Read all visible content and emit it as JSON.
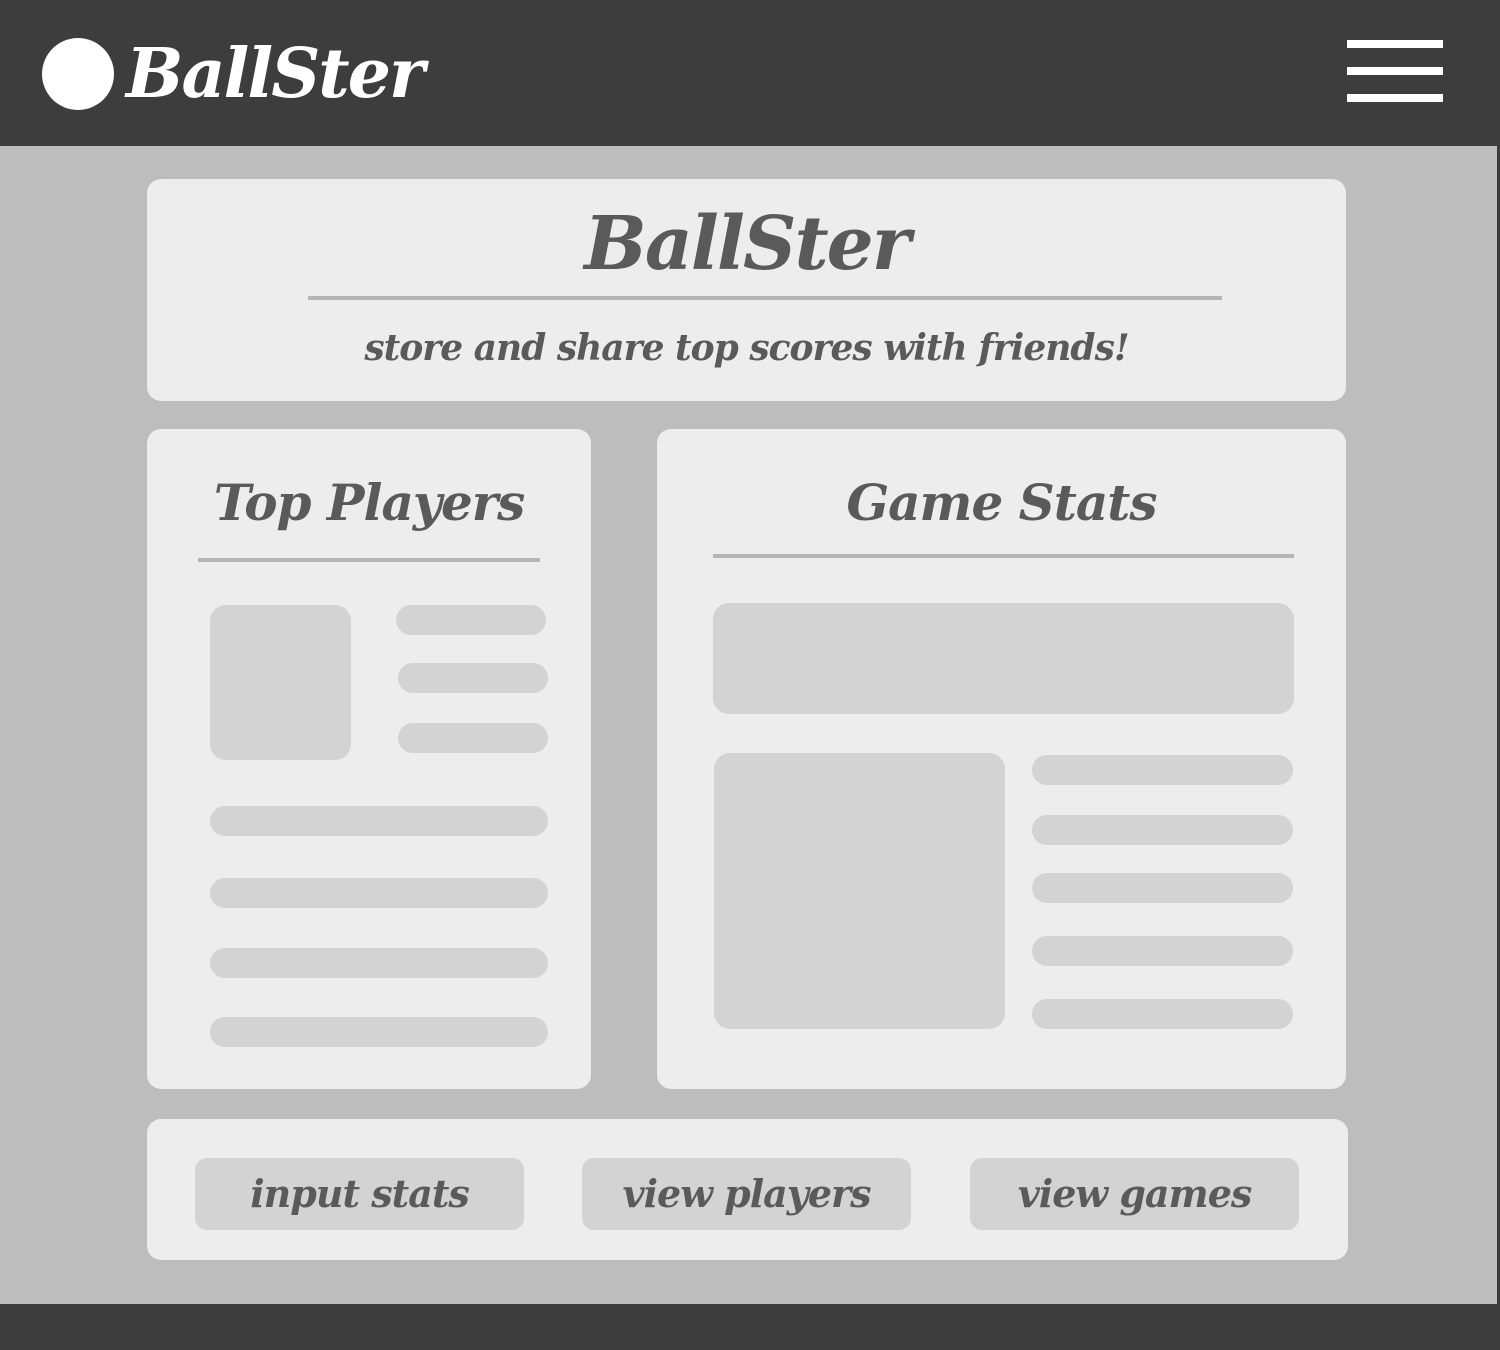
{
  "header": {
    "brand": "BallSter",
    "logo_icon": "circle-logo-icon",
    "menu_icon": "hamburger-menu-icon"
  },
  "hero": {
    "title": "BallSter",
    "subtitle": "store and share top scores with friends!"
  },
  "top_players": {
    "title": "Top Players"
  },
  "game_stats": {
    "title": "Game Stats"
  },
  "actions": {
    "input_stats": "input stats",
    "view_players": "view players",
    "view_games": "view games"
  },
  "colors": {
    "header_bg": "#3d3d3d",
    "page_bg": "#bdbdbd",
    "card_bg": "#ededed",
    "placeholder": "#d3d3d3",
    "text": "#5a5a5a"
  }
}
